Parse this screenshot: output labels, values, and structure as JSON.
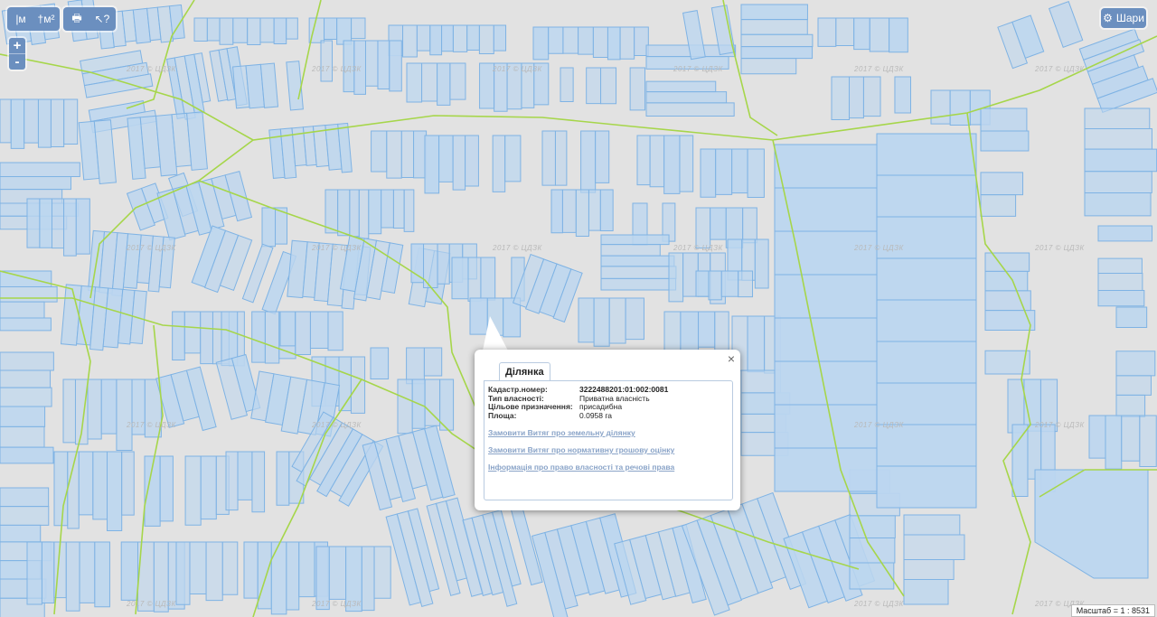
{
  "toolbar": {
    "groups": [
      [
        {
          "icon": "ruler-m-icon",
          "glyph": "|м",
          "name": "measure-distance-button"
        },
        {
          "icon": "ruler-area-icon",
          "glyph": "†м²",
          "name": "measure-area-button"
        }
      ],
      [
        {
          "icon": "print-icon",
          "glyph": "🖶",
          "name": "print-button"
        },
        {
          "icon": "identify-icon",
          "glyph": "↖?",
          "name": "identify-button"
        }
      ]
    ]
  },
  "zoom": {
    "in": "+",
    "out": "-"
  },
  "layers": {
    "label": "Шари",
    "icon": "gear-icon"
  },
  "watermark_text": "2017 © ЦДЗК",
  "popup": {
    "tab": "Ділянка",
    "close": "×",
    "fields": [
      {
        "label": "Кадастр.номер:",
        "value": "3222488201:01:002:0081",
        "strong": true
      },
      {
        "label": "Тип власності:",
        "value": "Приватна власність",
        "strong": false
      },
      {
        "label": "Цільове призначення:",
        "value": "присадибна",
        "strong": false
      },
      {
        "label": "Площа:",
        "value": "0.0958 га",
        "strong": false
      }
    ],
    "links": [
      "Замовити Витяг про земельну ділянку",
      "Замовити Витяг про нормативну грошову оцінку",
      "Інформація про право власності та речові права"
    ]
  },
  "scale": {
    "text": "Масштаб = 1 : 8531"
  },
  "colors": {
    "parcel_fill": "#bcd6ef",
    "parcel_stroke": "#7fb3e4",
    "boundary": "#a6d64a",
    "map_bg": "#e2e2e2",
    "button": "#6b8fbf"
  }
}
